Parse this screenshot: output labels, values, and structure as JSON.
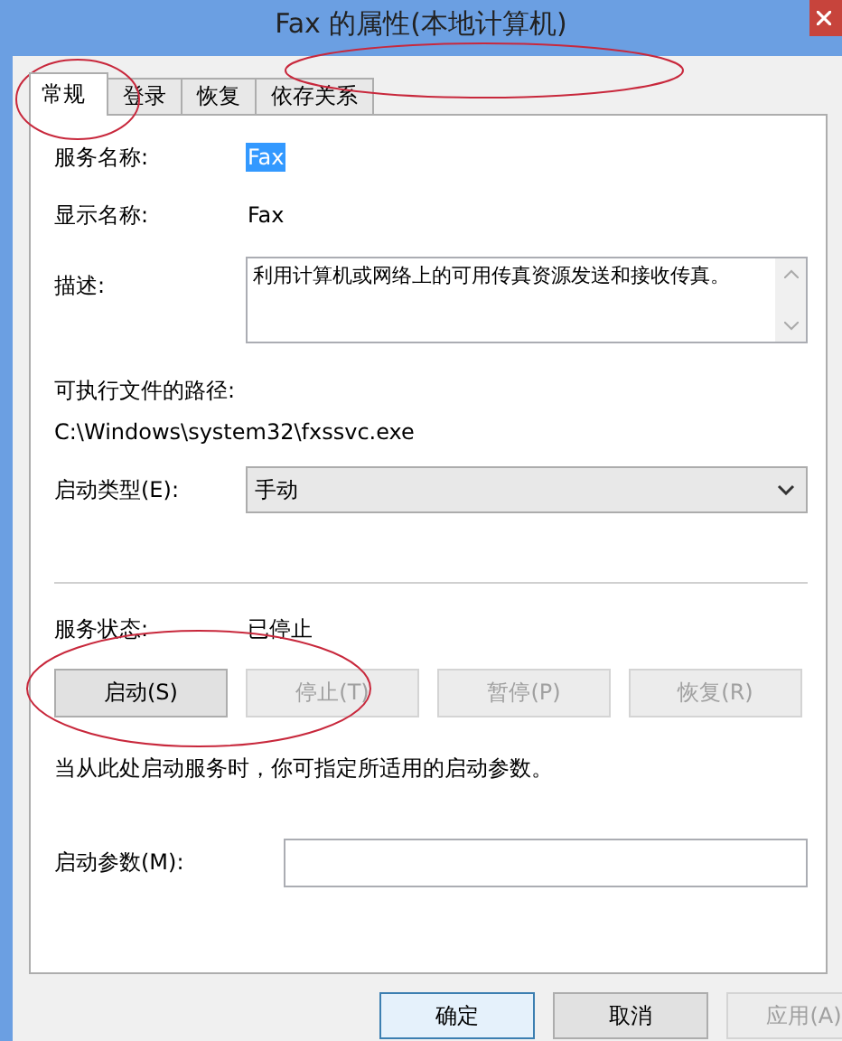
{
  "window": {
    "title": "Fax 的属性(本地计算机)"
  },
  "tabs": [
    {
      "label": "常规",
      "selected": true
    },
    {
      "label": "登录",
      "selected": false
    },
    {
      "label": "恢复",
      "selected": false
    },
    {
      "label": "依存关系",
      "selected": false
    }
  ],
  "fields": [
    {
      "kind": "text",
      "label": "服务名称:",
      "value": "Fax",
      "highlighted": true
    },
    {
      "kind": "text",
      "label": "显示名称:",
      "value": "Fax",
      "highlighted": false
    },
    {
      "kind": "textarea",
      "label": "描述:",
      "value": "利用计算机或网络上的可用传真资源发送和接收传真。"
    }
  ],
  "path": {
    "label": "可执行文件的路径:",
    "value": "C:\\Windows\\system32\\fxssvc.exe"
  },
  "startup_type": {
    "label": "启动类型(E):",
    "value": "手动"
  },
  "status": {
    "label": "服务状态:",
    "value": "已停止"
  },
  "service_buttons": [
    {
      "label": "启动(S)",
      "disabled": false
    },
    {
      "label": "停止(T)",
      "disabled": true
    },
    {
      "label": "暂停(P)",
      "disabled": true
    },
    {
      "label": "恢复(R)",
      "disabled": true
    }
  ],
  "hint": "当从此处启动服务时，你可指定所适用的启动参数。",
  "parameters": {
    "label": "启动参数(M):"
  },
  "dialog_buttons": [
    {
      "label": "确定",
      "disabled": false
    },
    {
      "label": "取消",
      "disabled": false
    },
    {
      "label": "应用(A)",
      "disabled": true
    }
  ],
  "annotations": [
    {
      "kind": "ellipse"
    },
    {
      "kind": "ellipse"
    },
    {
      "kind": "ellipse"
    }
  ]
}
